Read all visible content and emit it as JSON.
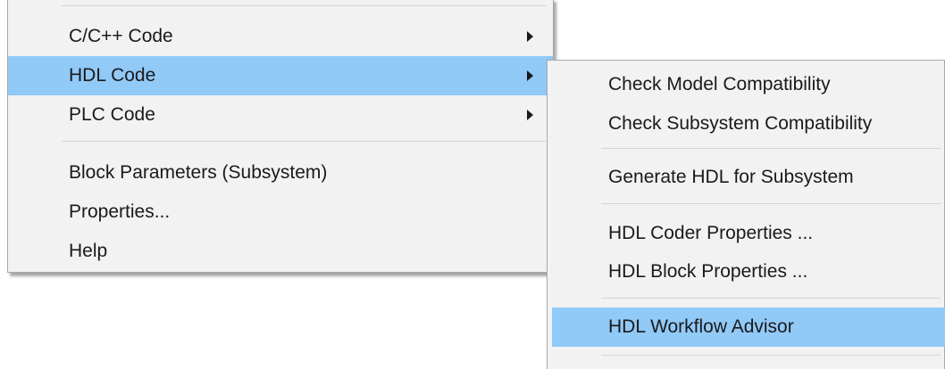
{
  "main_menu": {
    "items": [
      {
        "label": "C/C++ Code",
        "has_submenu": true,
        "highlighted": false
      },
      {
        "label": "HDL Code",
        "has_submenu": true,
        "highlighted": true
      },
      {
        "label": "PLC Code",
        "has_submenu": true,
        "highlighted": false
      },
      {
        "label": "Block Parameters (Subsystem)",
        "has_submenu": false,
        "highlighted": false
      },
      {
        "label": "Properties...",
        "has_submenu": false,
        "highlighted": false
      },
      {
        "label": "Help",
        "has_submenu": false,
        "highlighted": false
      }
    ]
  },
  "sub_menu": {
    "items": [
      {
        "label": "Check Model Compatibility",
        "highlighted": false
      },
      {
        "label": "Check Subsystem Compatibility",
        "highlighted": false
      },
      {
        "label": "Generate HDL for Subsystem",
        "highlighted": false
      },
      {
        "label": "HDL Coder Properties ...",
        "highlighted": false
      },
      {
        "label": "HDL Block Properties ...",
        "highlighted": false
      },
      {
        "label": "HDL Workflow Advisor",
        "highlighted": true
      }
    ]
  },
  "colors": {
    "menu_background": "#f2f2f2",
    "highlight": "#91c9f7",
    "separator": "#d4d4d4",
    "border": "#a9a9a9",
    "text": "#1a1a1a"
  },
  "icons": {
    "submenu_arrow": "submenu-arrow-icon"
  }
}
